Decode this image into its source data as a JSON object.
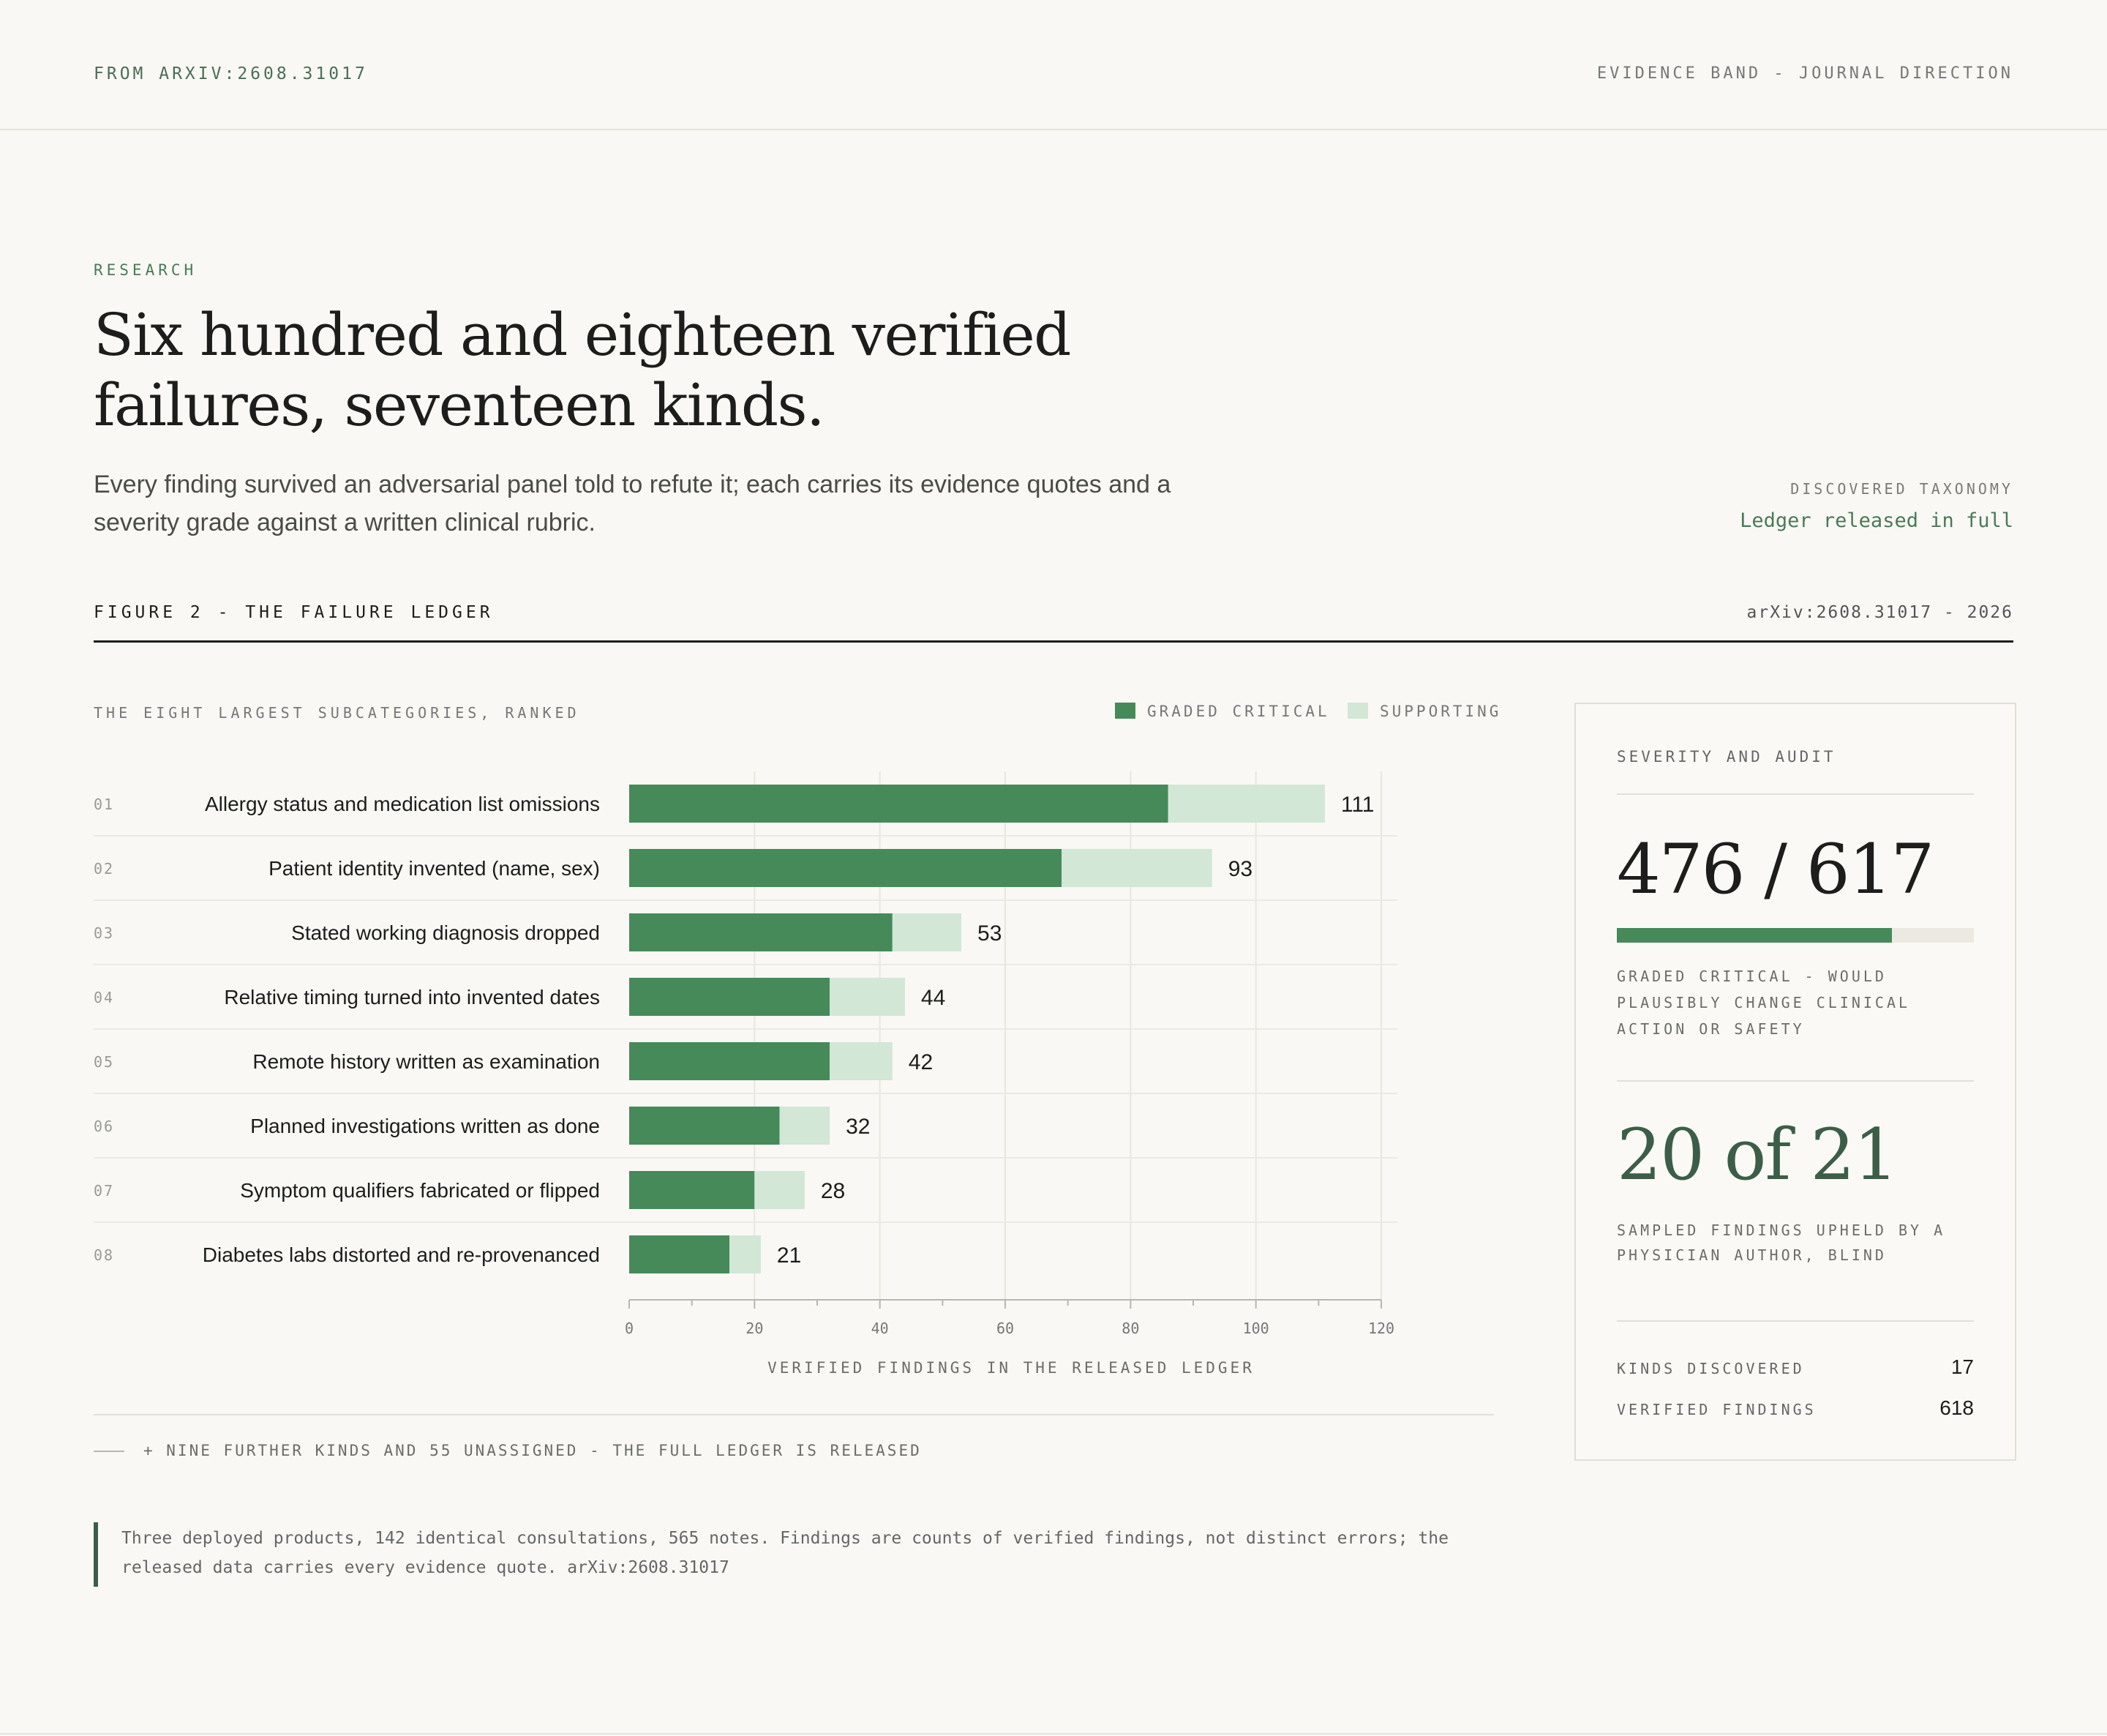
{
  "header": {
    "source": "FROM ARXIV:2608.31017",
    "band": "EVIDENCE BAND - JOURNAL DIRECTION"
  },
  "article": {
    "kicker": "RESEARCH",
    "title": "Six hundred and eighteen verified failures, seventeen kinds.",
    "lede": "Every finding survived an adversarial panel told to refute it; each carries its evidence quotes and a severity grade against a written clinical rubric.",
    "taxonomy_kicker": "DISCOVERED TAXONOMY",
    "taxonomy_link": "Ledger released in full"
  },
  "figure": {
    "label": "FIGURE 2 - THE FAILURE LEDGER",
    "ref": "arXiv:2608.31017 - 2026",
    "chart_kicker": "THE EIGHT LARGEST SUBCATEGORIES, RANKED",
    "legend": {
      "critical": "GRADED CRITICAL",
      "supporting": "SUPPORTING"
    },
    "more_note": "+ NINE FURTHER KINDS AND 55 UNASSIGNED - THE FULL LEDGER IS RELEASED",
    "footnote": "Three deployed products, 142 identical consultations, 565 notes. Findings are counts of verified findings, not distinct errors; the released data carries every evidence quote. arXiv:2608.31017"
  },
  "chart_data": {
    "type": "bar",
    "orientation": "horizontal",
    "stacked": true,
    "ranks": [
      "01",
      "02",
      "03",
      "04",
      "05",
      "06",
      "07",
      "08"
    ],
    "categories": [
      "Allergy status and medication list omissions",
      "Patient identity invented (name, sex)",
      "Stated working diagnosis dropped",
      "Relative timing turned into invented dates",
      "Remote history written as examination",
      "Planned investigations written as done",
      "Symptom qualifiers fabricated or flipped",
      "Diabetes labs distorted and re-provenanced"
    ],
    "series": [
      {
        "name": "GRADED CRITICAL",
        "values": [
          86,
          69,
          42,
          32,
          32,
          24,
          20,
          16
        ],
        "color": "#468a5a"
      },
      {
        "name": "SUPPORTING",
        "values": [
          25,
          24,
          11,
          12,
          10,
          8,
          8,
          5
        ],
        "color": "#d2e7d6"
      }
    ],
    "totals": [
      111,
      93,
      53,
      44,
      42,
      32,
      28,
      21
    ],
    "xlabel": "VERIFIED FINDINGS IN THE RELEASED LEDGER",
    "xlim": [
      0,
      120
    ],
    "xticks": [
      0,
      20,
      40,
      60,
      80,
      100,
      120
    ],
    "grid": true
  },
  "panel": {
    "kicker": "SEVERITY AND AUDIT",
    "critical_ratio": "476 / 617",
    "critical_fraction": 0.7715,
    "critical_caption": "GRADED CRITICAL - WOULD PLAUSIBLY CHANGE CLINICAL ACTION OR SAFETY",
    "audit_ratio": "20 of 21",
    "audit_caption": "SAMPLED FINDINGS UPHELD BY A PHYSICIAN AUTHOR, BLIND",
    "stats": [
      {
        "label": "KINDS DISCOVERED",
        "value": "17"
      },
      {
        "label": "VERIFIED FINDINGS",
        "value": "618"
      }
    ]
  }
}
